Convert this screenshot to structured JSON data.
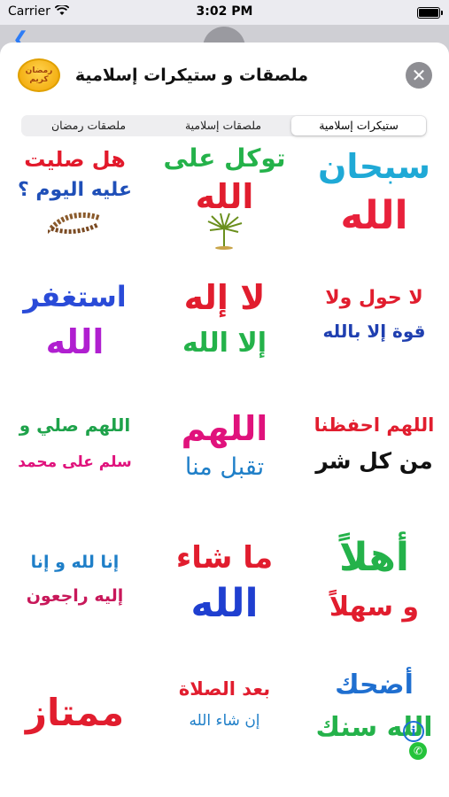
{
  "status_bar": {
    "carrier": "Carrier",
    "time": "3:02 PM"
  },
  "header": {
    "app_icon_text": "رمضان كريم",
    "title": "ملصقات و ستيكرات إسلامية",
    "close_glyph": "✕"
  },
  "tabs": [
    {
      "label": "ستيكرات إسلامية",
      "selected": true
    },
    {
      "label": "ملصقات إسلامية",
      "selected": false
    },
    {
      "label": "ملصقات رمضان",
      "selected": false
    }
  ],
  "stickers": [
    {
      "line1": "سبحان",
      "line2": "الله",
      "color1": "#1fa9d6",
      "color2": "#e8213b"
    },
    {
      "line1": "توكل على",
      "line2": "الله",
      "color1": "#24b24a",
      "color2": "#e11d2e",
      "extra": "palm-icon"
    },
    {
      "line1": "هل صليت",
      "line2": "عليه اليوم ؟",
      "color1": "#e2192b",
      "color2": "#1f4fb8",
      "extra": "prayer-beads-icon"
    },
    {
      "line1": "لا حول ولا",
      "line2": "قوة إلا بالله",
      "color1": "#e11d2e",
      "color2": "#1f3fb0"
    },
    {
      "line1": "لا إله",
      "line2": "إلا الله",
      "color1": "#e11d2e",
      "color2": "#24b24a"
    },
    {
      "line1": "استغفر",
      "line2": "الله",
      "color1": "#2a4bd8",
      "color2": "#b01fd0"
    },
    {
      "line1": "اللهم احفظنا",
      "line2": "من كل شر",
      "color1": "#e11d2e",
      "color2": "#111111"
    },
    {
      "line1": "اللهم",
      "line2": "تقبل منا",
      "color1": "#e0127c",
      "color2": "#1f7fc8"
    },
    {
      "line1": "اللهم صلي و",
      "line2": "سلم على محمد",
      "color1": "#1ea24a",
      "color2": "#e0127c"
    },
    {
      "line1": "أهلاً",
      "line2": "و سهلاً",
      "color1": "#24b24a",
      "color2": "#e11d2e"
    },
    {
      "line1": "ما شاء",
      "line2": "الله",
      "color1": "#e11d2e",
      "color2": "#1f3fd0"
    },
    {
      "line1": "إنا لله و إنا",
      "line2": "إليه راجعون",
      "color1": "#1f7fc8",
      "color2": "#c8185a"
    },
    {
      "line1": "أضحك",
      "line2": "الله سنك",
      "color1": "#1f6fd0",
      "color2": "#24b24a",
      "extra": "whatsapp-icon"
    },
    {
      "line1": "بعد الصلاة",
      "line2": "إن شاء الله",
      "color1": "#e11d2e",
      "color2": "#1f7fc8"
    },
    {
      "line1": "ممتاز",
      "line2": "",
      "color1": "#e11d2e",
      "color2": "#e11d2e"
    }
  ],
  "info_glyph": "i"
}
